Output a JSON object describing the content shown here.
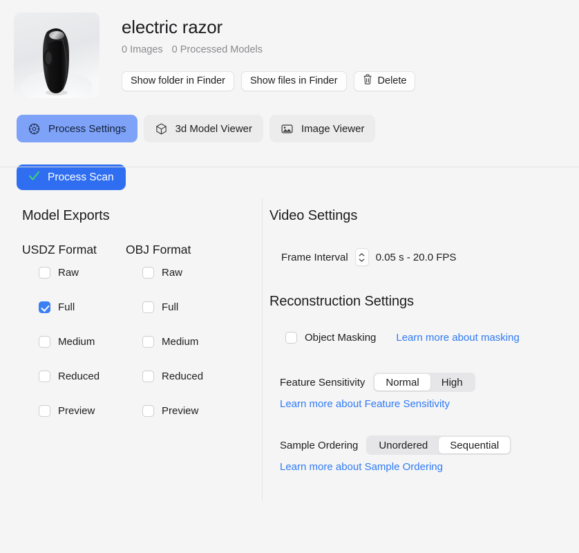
{
  "header": {
    "thumbnail_alt": "electric-razor-photo",
    "title": "electric razor",
    "images_count": "0 Images",
    "models_count": "0 Processed Models",
    "buttons": [
      {
        "label": "Show folder in Finder",
        "icon": null
      },
      {
        "label": "Show files in Finder",
        "icon": null
      },
      {
        "label": "Delete",
        "icon": "trash-icon"
      }
    ]
  },
  "tabs": [
    {
      "label": "Process Settings",
      "icon": "gear-icon",
      "active": true
    },
    {
      "label": "3d Model Viewer",
      "icon": "cube-icon",
      "active": false
    },
    {
      "label": "Image Viewer",
      "icon": "photo-icon",
      "active": false
    }
  ],
  "process": {
    "button_label": "Process Scan",
    "button_icon": "checkmark-icon",
    "button_color": "#2f6ef0",
    "check_color": "#34c759"
  },
  "model_exports": {
    "title": "Model Exports",
    "columns": [
      {
        "name": "USDZ Format",
        "options": [
          {
            "label": "Raw",
            "checked": false
          },
          {
            "label": "Full",
            "checked": true
          },
          {
            "label": "Medium",
            "checked": false
          },
          {
            "label": "Reduced",
            "checked": false
          },
          {
            "label": "Preview",
            "checked": false
          }
        ]
      },
      {
        "name": "OBJ Format",
        "options": [
          {
            "label": "Raw",
            "checked": false
          },
          {
            "label": "Full",
            "checked": false
          },
          {
            "label": "Medium",
            "checked": false
          },
          {
            "label": "Reduced",
            "checked": false
          },
          {
            "label": "Preview",
            "checked": false
          }
        ]
      }
    ],
    "checked_color": "#3b7ff5"
  },
  "video_settings": {
    "title": "Video Settings",
    "frame_interval_label": "Frame Interval",
    "frame_interval_value": "0.05 s - 20.0 FPS"
  },
  "reconstruction_settings": {
    "title": "Reconstruction Settings",
    "object_masking": {
      "label": "Object Masking",
      "checked": false,
      "link": "Learn more about masking"
    },
    "feature_sensitivity": {
      "label": "Feature Sensitivity",
      "options": [
        "Normal",
        "High"
      ],
      "selected": "Normal",
      "link": "Learn more about Feature Sensitivity"
    },
    "sample_ordering": {
      "label": "Sample Ordering",
      "options": [
        "Unordered",
        "Sequential"
      ],
      "selected": "Sequential",
      "link": "Learn more about Sample Ordering"
    },
    "link_color": "#2f7af5"
  }
}
